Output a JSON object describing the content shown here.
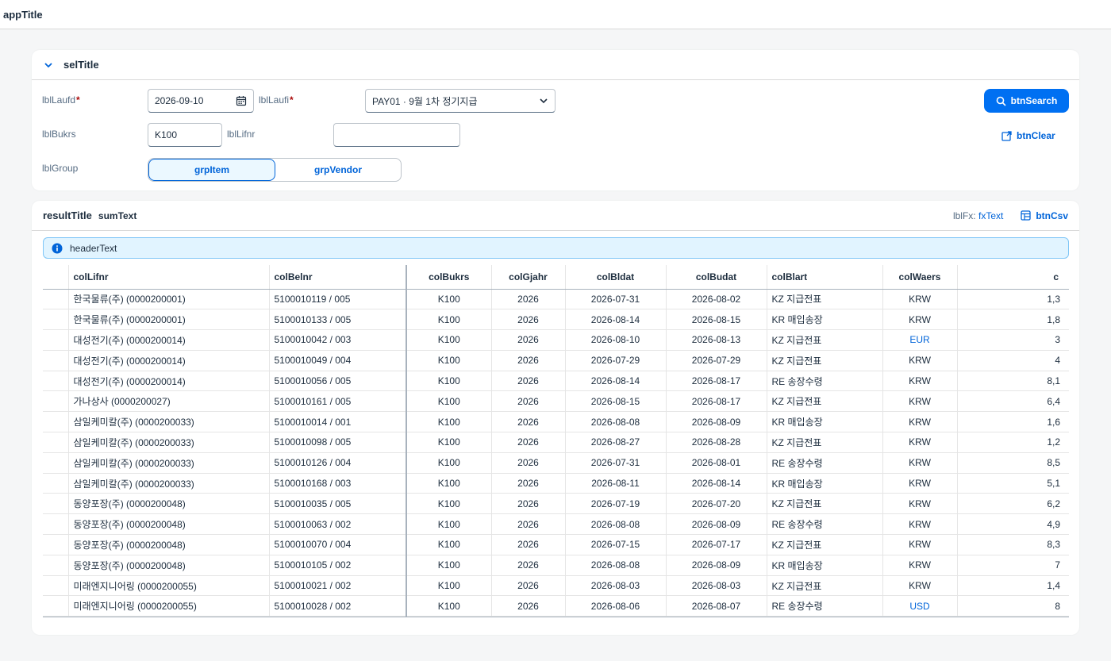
{
  "app": {
    "title": "appTitle"
  },
  "filter": {
    "title": "selTitle",
    "laufd": {
      "label": "lblLaufd",
      "value": "2026-09-10"
    },
    "laufi": {
      "label": "lblLaufi",
      "value": "PAY01 · 9월 1차 정기지급"
    },
    "bukrs": {
      "label": "lblBukrs",
      "value": "K100"
    },
    "lifnr": {
      "label": "lblLifnr",
      "value": ""
    },
    "group": {
      "label": "lblGroup",
      "options": [
        "grpItem",
        "grpVendor"
      ],
      "selected": "grpItem"
    },
    "search_label": "btnSearch",
    "clear_label": "btnClear",
    "required_mark": "*"
  },
  "result": {
    "title": "resultTitle",
    "sum": "sumText",
    "fx_label": "lblFx:",
    "fx_value": "fxText",
    "csv_label": "btnCsv",
    "header_text": "headerText",
    "columns": [
      "colLifnr",
      "colBelnr",
      "colBukrs",
      "colGjahr",
      "colBldat",
      "colBudat",
      "colBlart",
      "colWaers",
      "c"
    ],
    "rows": [
      [
        "한국물류(주) (0000200001)",
        "5100010119 / 005",
        "K100",
        "2026",
        "2026-07-31",
        "2026-08-02",
        "KZ 지급전표",
        "KRW",
        "1,3"
      ],
      [
        "한국물류(주) (0000200001)",
        "5100010133 / 005",
        "K100",
        "2026",
        "2026-08-14",
        "2026-08-15",
        "KR 매입송장",
        "KRW",
        "1,8"
      ],
      [
        "대성전기(주) (0000200014)",
        "5100010042 / 003",
        "K100",
        "2026",
        "2026-08-10",
        "2026-08-13",
        "KZ 지급전표",
        "EUR",
        "3"
      ],
      [
        "대성전기(주) (0000200014)",
        "5100010049 / 004",
        "K100",
        "2026",
        "2026-07-29",
        "2026-07-29",
        "KZ 지급전표",
        "KRW",
        "4"
      ],
      [
        "대성전기(주) (0000200014)",
        "5100010056 / 005",
        "K100",
        "2026",
        "2026-08-14",
        "2026-08-17",
        "RE 송장수령",
        "KRW",
        "8,1"
      ],
      [
        "가나상사 (0000200027)",
        "5100010161 / 005",
        "K100",
        "2026",
        "2026-08-15",
        "2026-08-17",
        "KZ 지급전표",
        "KRW",
        "6,4"
      ],
      [
        "삼일케미칼(주) (0000200033)",
        "5100010014 / 001",
        "K100",
        "2026",
        "2026-08-08",
        "2026-08-09",
        "KR 매입송장",
        "KRW",
        "1,6"
      ],
      [
        "삼일케미칼(주) (0000200033)",
        "5100010098 / 005",
        "K100",
        "2026",
        "2026-08-27",
        "2026-08-28",
        "KZ 지급전표",
        "KRW",
        "1,2"
      ],
      [
        "삼일케미칼(주) (0000200033)",
        "5100010126 / 004",
        "K100",
        "2026",
        "2026-07-31",
        "2026-08-01",
        "RE 송장수령",
        "KRW",
        "8,5"
      ],
      [
        "삼일케미칼(주) (0000200033)",
        "5100010168 / 003",
        "K100",
        "2026",
        "2026-08-11",
        "2026-08-14",
        "KR 매입송장",
        "KRW",
        "5,1"
      ],
      [
        "동양포장(주) (0000200048)",
        "5100010035 / 005",
        "K100",
        "2026",
        "2026-07-19",
        "2026-07-20",
        "KZ 지급전표",
        "KRW",
        "6,2"
      ],
      [
        "동양포장(주) (0000200048)",
        "5100010063 / 002",
        "K100",
        "2026",
        "2026-08-08",
        "2026-08-09",
        "RE 송장수령",
        "KRW",
        "4,9"
      ],
      [
        "동양포장(주) (0000200048)",
        "5100010070 / 004",
        "K100",
        "2026",
        "2026-07-15",
        "2026-07-17",
        "KZ 지급전표",
        "KRW",
        "8,3"
      ],
      [
        "동양포장(주) (0000200048)",
        "5100010105 / 002",
        "K100",
        "2026",
        "2026-08-08",
        "2026-08-09",
        "KR 매입송장",
        "KRW",
        "7"
      ],
      [
        "미래엔지니어링 (0000200055)",
        "5100010021 / 002",
        "K100",
        "2026",
        "2026-08-03",
        "2026-08-03",
        "KZ 지급전표",
        "KRW",
        "1,4"
      ],
      [
        "미래엔지니어링 (0000200055)",
        "5100010028 / 002",
        "K100",
        "2026",
        "2026-08-06",
        "2026-08-07",
        "RE 송장수령",
        "USD",
        "8"
      ]
    ]
  },
  "colors": {
    "accent": "#0070f2",
    "link": "#0064d9",
    "required": "#aa0808",
    "info_bg": "#e1f4ff"
  }
}
